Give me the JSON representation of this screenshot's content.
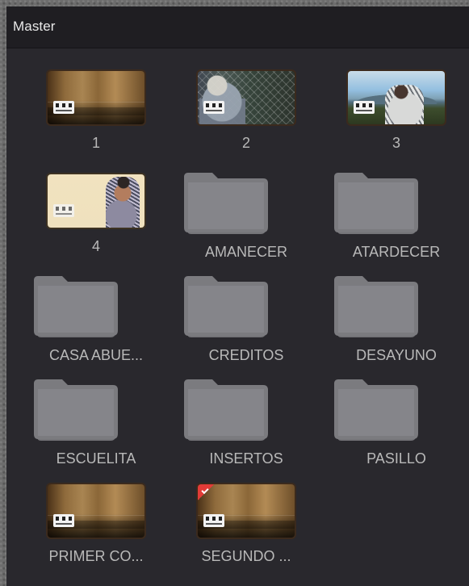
{
  "panel": {
    "title": "Master"
  },
  "items": [
    {
      "label": "1",
      "type": "clip",
      "thumb_style": "sepia"
    },
    {
      "label": "2",
      "type": "clip",
      "thumb_style": "fence"
    },
    {
      "label": "3",
      "type": "clip",
      "thumb_style": "view"
    },
    {
      "label": "4",
      "type": "clip",
      "thumb_style": "portrait"
    },
    {
      "label": "AMANECER",
      "type": "folder"
    },
    {
      "label": "ATARDECER",
      "type": "folder"
    },
    {
      "label": "CASA ABUE...",
      "type": "folder"
    },
    {
      "label": "CREDITOS",
      "type": "folder"
    },
    {
      "label": "DESAYUNO",
      "type": "folder"
    },
    {
      "label": "ESCUELITA",
      "type": "folder"
    },
    {
      "label": "INSERTOS",
      "type": "folder"
    },
    {
      "label": "PASILLO",
      "type": "folder"
    },
    {
      "label": "PRIMER CO...",
      "type": "clip",
      "thumb_style": "sepia"
    },
    {
      "label": "SEGUNDO ...",
      "type": "clip",
      "thumb_style": "sepia",
      "flagged": true
    }
  ],
  "colors": {
    "panel_bg": "#29282d",
    "header_bg": "#1f1e22",
    "text": "#b9b9b9",
    "folder": "#7a7a7d",
    "flag": "#e33b37"
  },
  "icons": {
    "clip": "video-clip-icon",
    "folder": "folder-icon",
    "flag": "red-flag-icon"
  }
}
